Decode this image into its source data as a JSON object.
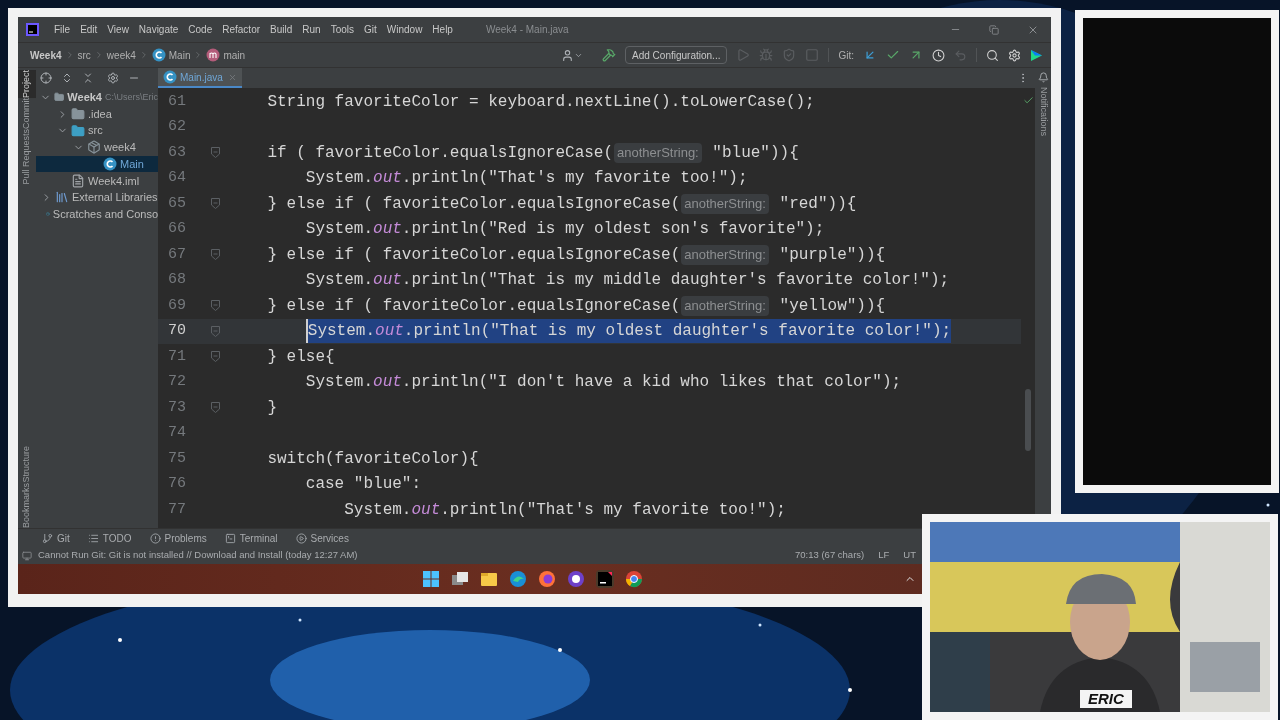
{
  "window": {
    "title": "Week4 - Main.java"
  },
  "menu": [
    "File",
    "Edit",
    "View",
    "Navigate",
    "Code",
    "Refactor",
    "Build",
    "Run",
    "Tools",
    "Git",
    "Window",
    "Help"
  ],
  "breadcrumbs": [
    {
      "label": "Week4",
      "kind": "project"
    },
    {
      "label": "src",
      "kind": "folder"
    },
    {
      "label": "week4",
      "kind": "folder"
    },
    {
      "label": "Main",
      "kind": "class"
    },
    {
      "label": "main",
      "kind": "method"
    }
  ],
  "toolbar": {
    "run_configuration": "Add Configuration...",
    "run_actions": [
      {
        "kind": "run",
        "disabled": true
      },
      {
        "kind": "debug",
        "disabled": true
      },
      {
        "kind": "coverage",
        "disabled": true
      },
      {
        "kind": "stop",
        "disabled": true
      }
    ],
    "vcs_label": "Git:"
  },
  "side_tabs": [
    {
      "label": "Project",
      "selected": true
    },
    {
      "label": "Commit",
      "selected": false
    },
    {
      "label": "Pull Requests",
      "selected": false
    },
    {
      "label": "Structure",
      "selected": false
    },
    {
      "label": "Bookmarks",
      "selected": false
    }
  ],
  "right_tabs": [
    {
      "label": "Notifications"
    }
  ],
  "project_tree": [
    {
      "label": "Week4",
      "kind": "module",
      "path": "C:\\Users\\Eric",
      "expanded": true,
      "selected": false,
      "children": [
        {
          "label": ".idea",
          "kind": "folder",
          "expanded": false,
          "selected": false
        },
        {
          "label": "src",
          "kind": "source",
          "expanded": true,
          "selected": false,
          "children": [
            {
              "label": "week4",
              "kind": "package",
              "expanded": true,
              "selected": false,
              "children": [
                {
                  "label": "Main",
                  "kind": "class",
                  "selected": true
                }
              ]
            }
          ]
        },
        {
          "label": "Week4.iml",
          "kind": "file",
          "selected": false
        }
      ]
    },
    {
      "label": "External Libraries",
      "kind": "library",
      "expanded": false,
      "selected": false
    },
    {
      "label": "Scratches and Conso",
      "kind": "scratch",
      "selected": false
    }
  ],
  "editor_tabs": [
    {
      "label": "Main.java",
      "selected": true
    }
  ],
  "code_lines": [
    {
      "number": "61",
      "fold": false,
      "selected": false,
      "tokens": [
        {
          "kind": "code",
          "text": "    String favoriteColor = keyboard.nextLine().toLowerCase();"
        }
      ]
    },
    {
      "number": "62",
      "fold": false,
      "selected": false
    },
    {
      "number": "63",
      "fold": true,
      "selected": false,
      "tokens": [
        {
          "kind": "code",
          "text": "    if ( favoriteColor.equalsIgnoreCase("
        },
        {
          "kind": "hint",
          "text": "anotherString:"
        },
        {
          "kind": "code",
          "text": " \"blue\")){"
        }
      ]
    },
    {
      "number": "64",
      "fold": false,
      "selected": false,
      "tokens": [
        {
          "kind": "code",
          "text": "        System."
        },
        {
          "kind": "field",
          "text": "out"
        },
        {
          "kind": "code",
          "text": ".println(\"That's my favorite too!\");"
        }
      ]
    },
    {
      "number": "65",
      "fold": true,
      "selected": false,
      "tokens": [
        {
          "kind": "code",
          "text": "    } else if ( favoriteColor.equalsIgnoreCase("
        },
        {
          "kind": "hint",
          "text": "anotherString:"
        },
        {
          "kind": "code",
          "text": " \"red\")){"
        }
      ]
    },
    {
      "number": "66",
      "fold": false,
      "selected": false,
      "tokens": [
        {
          "kind": "code",
          "text": "        System."
        },
        {
          "kind": "field",
          "text": "out"
        },
        {
          "kind": "code",
          "text": ".println(\"Red is my oldest son's favorite\");"
        }
      ]
    },
    {
      "number": "67",
      "fold": true,
      "selected": false,
      "tokens": [
        {
          "kind": "code",
          "text": "    } else if ( favoriteColor.equalsIgnoreCase("
        },
        {
          "kind": "hint",
          "text": "anotherString:"
        },
        {
          "kind": "code",
          "text": " \"purple\")){"
        }
      ]
    },
    {
      "number": "68",
      "fold": false,
      "selected": false,
      "tokens": [
        {
          "kind": "code",
          "text": "        System."
        },
        {
          "kind": "field",
          "text": "out"
        },
        {
          "kind": "code",
          "text": ".println(\"That is my middle daughter's favorite color!\");"
        }
      ]
    },
    {
      "number": "69",
      "fold": true,
      "selected": false,
      "tokens": [
        {
          "kind": "code",
          "text": "    } else if ( favoriteColor.equalsIgnoreCase("
        },
        {
          "kind": "hint",
          "text": "anotherString:"
        },
        {
          "kind": "code",
          "text": " \"yellow\")){"
        }
      ]
    },
    {
      "number": "70",
      "fold": true,
      "selected": true,
      "tokens": [
        {
          "kind": "code",
          "text": "        System."
        },
        {
          "kind": "field",
          "text": "out"
        },
        {
          "kind": "code",
          "text": ".println(\"That is my oldest daughter's favorite color!\");"
        }
      ]
    },
    {
      "number": "71",
      "fold": true,
      "selected": false,
      "tokens": [
        {
          "kind": "code",
          "text": "    } else{"
        }
      ]
    },
    {
      "number": "72",
      "fold": false,
      "selected": false,
      "tokens": [
        {
          "kind": "code",
          "text": "        System."
        },
        {
          "kind": "field",
          "text": "out"
        },
        {
          "kind": "code",
          "text": ".println(\"I don't have a kid who likes that color\");"
        }
      ]
    },
    {
      "number": "73",
      "fold": true,
      "selected": false,
      "tokens": [
        {
          "kind": "code",
          "text": "    }"
        }
      ]
    },
    {
      "number": "74",
      "fold": false,
      "selected": false
    },
    {
      "number": "75",
      "fold": false,
      "selected": false,
      "tokens": [
        {
          "kind": "code",
          "text": "    switch(favoriteColor){"
        }
      ]
    },
    {
      "number": "76",
      "fold": false,
      "selected": false,
      "tokens": [
        {
          "kind": "code",
          "text": "        case \"blue\":"
        }
      ]
    },
    {
      "number": "77",
      "fold": false,
      "selected": false,
      "tokens": [
        {
          "kind": "code",
          "text": "            System."
        },
        {
          "kind": "field",
          "text": "out"
        },
        {
          "kind": "code",
          "text": ".println(\"That's my favorite too!\");"
        }
      ]
    }
  ],
  "tool_windows": [
    {
      "label": "Git",
      "kind": "git"
    },
    {
      "label": "TODO",
      "kind": "todo"
    },
    {
      "label": "Problems",
      "kind": "problems"
    },
    {
      "label": "Terminal",
      "kind": "terminal"
    },
    {
      "label": "Services",
      "kind": "services"
    }
  ],
  "status_bar": {
    "message": "Cannot Run Git: Git is not installed // Download and Install (today 12:27 AM)",
    "position": "70:13 (67 chars)",
    "line_separator": "LF",
    "encoding": "UT"
  },
  "taskbar": [
    {
      "kind": "start"
    },
    {
      "kind": "taskview"
    },
    {
      "kind": "explorer"
    },
    {
      "kind": "edge"
    },
    {
      "kind": "firefox"
    },
    {
      "kind": "github"
    },
    {
      "kind": "intellij"
    },
    {
      "kind": "chrome"
    }
  ],
  "webcam": {
    "name_label": "ERIC"
  }
}
